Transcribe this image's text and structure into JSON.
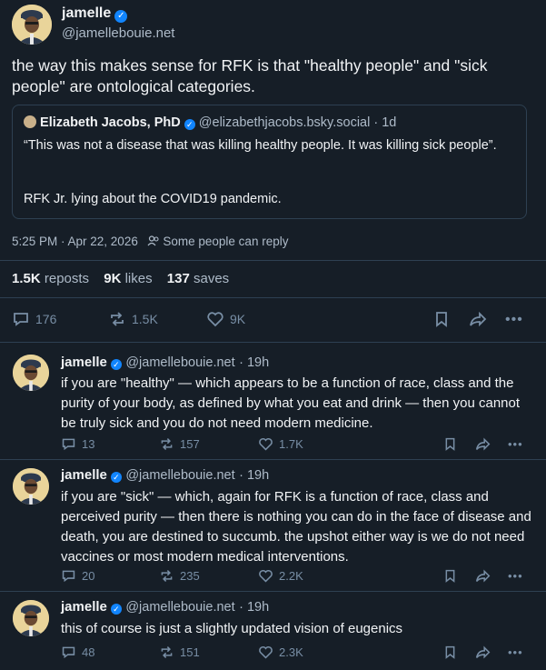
{
  "main_post": {
    "author_name": "jamelle",
    "author_handle": "@jamellebouie.net",
    "text": "the way this makes sense for RFK is that \"healthy people\" and \"sick people\" are ontological categories.",
    "quote": {
      "author_name": "Elizabeth Jacobs, PhD",
      "author_handle": "@elizabethjacobs.bsky.social",
      "age": "· 1d",
      "text_line1": "“This was not a disease that was killing healthy people. It was killing sick people”.",
      "text_line2": "RFK Jr. lying about the COVID19 pandemic."
    },
    "timestamp": "5:25 PM · Apr 22, 2026",
    "reply_setting": "Some people can reply",
    "stats": {
      "reposts_count": "1.5K",
      "reposts_label": "reposts",
      "likes_count": "9K",
      "likes_label": "likes",
      "saves_count": "137",
      "saves_label": "saves"
    },
    "actions": {
      "replies": "176",
      "reposts": "1.5K",
      "likes": "9K"
    }
  },
  "replies": [
    {
      "author_name": "jamelle",
      "author_handle": "@jamellebouie.net",
      "age": "· 19h",
      "text": "if you are \"healthy\" — which appears to be a function of race, class and the purity of your body, as defined by what you eat and drink — then you cannot be truly sick and you do not need modern medicine.",
      "replies": "13",
      "reposts": "157",
      "likes": "1.7K"
    },
    {
      "author_name": "jamelle",
      "author_handle": "@jamellebouie.net",
      "age": "· 19h",
      "text": "if you are \"sick\" — which, again for RFK is a function of race, class and perceived purity — then there is nothing you can do in the face of disease and death, you are destined to succumb. the upshot either way is we do not need vaccines or most modern medical interventions.",
      "replies": "20",
      "reposts": "235",
      "likes": "2.2K"
    },
    {
      "author_name": "jamelle",
      "author_handle": "@jamellebouie.net",
      "age": "· 19h",
      "text": "this of course is just a slightly updated vision of eugenics",
      "replies": "48",
      "reposts": "151",
      "likes": "2.3K"
    }
  ],
  "colors": {
    "background": "#161e27",
    "accent": "#1185fe",
    "muted": "#788ea5",
    "divider": "#2e4052"
  }
}
